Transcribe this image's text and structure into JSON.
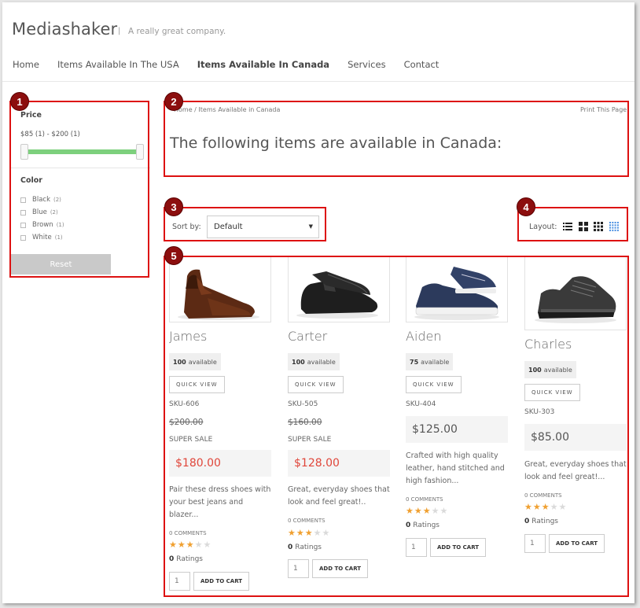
{
  "header": {
    "brand": "Mediashaker",
    "separator": "|",
    "tagline": "A really great company.",
    "nav": [
      "Home",
      "Items Available In The USA",
      "Items Available In Canada",
      "Services",
      "Contact"
    ],
    "active_nav": "Items Available In Canada"
  },
  "filters": {
    "price_title": "Price",
    "price_range": "$85 (1) - $200 (1)",
    "color_title": "Color",
    "colors": [
      {
        "label": "Black",
        "count": "(2)"
      },
      {
        "label": "Blue",
        "count": "(2)"
      },
      {
        "label": "Brown",
        "count": "(1)"
      },
      {
        "label": "White",
        "count": "(1)"
      }
    ],
    "reset_label": "Reset"
  },
  "breadcrumb": {
    "text": "Home  /  Items Available in Canada"
  },
  "print_label": "Print This Page",
  "page_heading": "The following items are available in Canada:",
  "sort": {
    "label": "Sort by:",
    "value": "Default",
    "caret": "▼"
  },
  "layout": {
    "label": "Layout:",
    "icons": [
      "list-view-icon",
      "grid-2-icon",
      "grid-3-icon",
      "grid-4-icon"
    ],
    "active": "grid-4-icon"
  },
  "products": [
    {
      "name": "James",
      "available_count": "100",
      "available_text": "available",
      "quick_view": "QUICK VIEW",
      "sku": "SKU-606",
      "old_price": "$200.00",
      "sale_label": "SUPER SALE",
      "price": "$180.00",
      "description": "Pair these dress shoes with your best jeans and blazer...",
      "comments": "0 COMMENTS",
      "rating_stars": 3,
      "ratings_count": "0",
      "ratings_label": "Ratings",
      "qty": "1",
      "add_to_cart": "ADD TO CART"
    },
    {
      "name": "Carter",
      "available_count": "100",
      "available_text": "available",
      "quick_view": "QUICK VIEW",
      "sku": "SKU-505",
      "old_price": "$160.00",
      "sale_label": "SUPER SALE",
      "price": "$128.00",
      "description": "Great, everyday shoes that look and feel great!..",
      "comments": "0 COMMENTS",
      "rating_stars": 3,
      "ratings_count": "0",
      "ratings_label": "Ratings",
      "qty": "1",
      "add_to_cart": "ADD TO CART"
    },
    {
      "name": "Aiden",
      "available_count": "75",
      "available_text": "available",
      "quick_view": "QUICK VIEW",
      "sku": "SKU-404",
      "price": "$125.00",
      "description": "Crafted with high quality leather, hand stitched and high fashion...",
      "comments": "0 COMMENTS",
      "rating_stars": 3,
      "ratings_count": "0",
      "ratings_label": "Ratings",
      "qty": "1",
      "add_to_cart": "ADD TO CART"
    },
    {
      "name": "Charles",
      "available_count": "100",
      "available_text": "available",
      "quick_view": "QUICK VIEW",
      "sku": "SKU-303",
      "price": "$85.00",
      "description": "Great, everyday shoes that look and feel great!...",
      "comments": "0 COMMENTS",
      "rating_stars": 3,
      "ratings_count": "0",
      "ratings_label": "Ratings",
      "qty": "1",
      "add_to_cart": "ADD TO CART"
    }
  ],
  "callouts": [
    "1",
    "2",
    "3",
    "4",
    "5"
  ],
  "colors": {
    "accent_red": "#e0463a",
    "callout_red": "#d11111",
    "badge": "#8c0e0e",
    "slider_green": "#7dd07d",
    "star": "#f0a030"
  }
}
